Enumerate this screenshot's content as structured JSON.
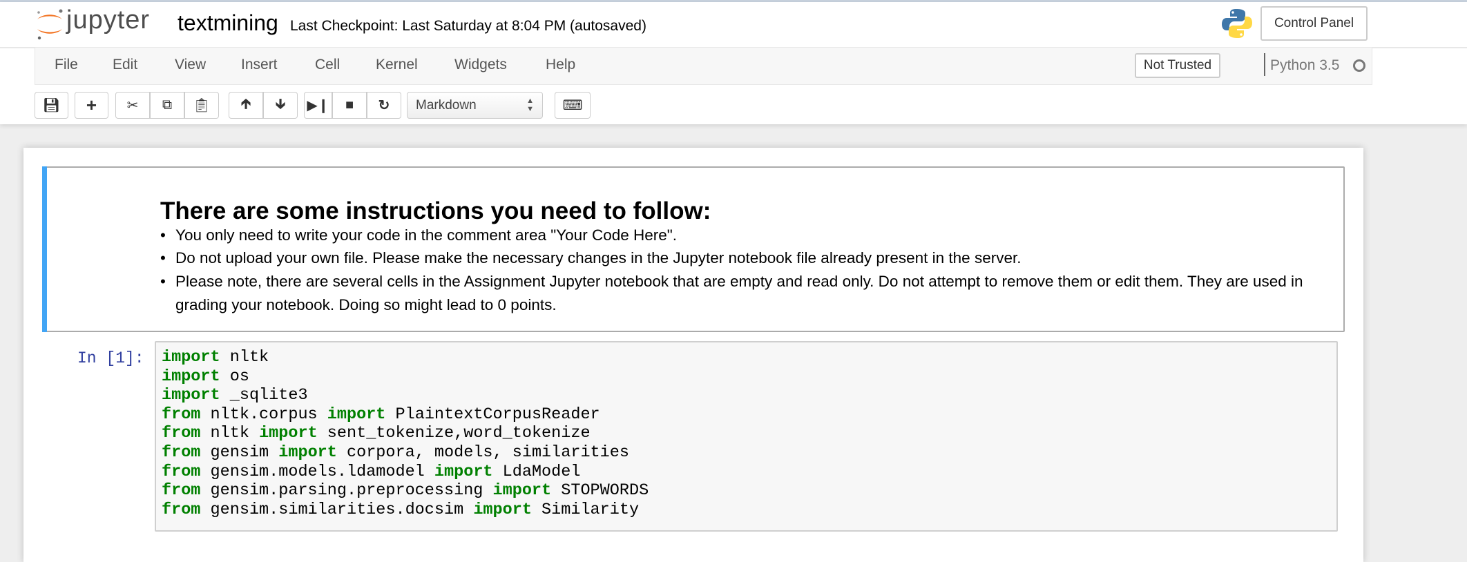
{
  "header": {
    "logo_text": "jupyter",
    "notebook_title": "textmining",
    "checkpoint": "Last Checkpoint: Last Saturday at 8:04 PM (autosaved)",
    "control_panel": "Control Panel"
  },
  "menubar": {
    "items": [
      "File",
      "Edit",
      "View",
      "Insert",
      "Cell",
      "Kernel",
      "Widgets",
      "Help"
    ],
    "trust": "Not Trusted",
    "kernel": "Python 3.5"
  },
  "toolbar": {
    "cell_type": "Markdown",
    "icons": [
      "save-icon",
      "plus-icon",
      "cut-icon",
      "copy-icon",
      "paste-icon",
      "arrow-up-icon",
      "arrow-down-icon",
      "run-icon",
      "stop-icon",
      "restart-icon",
      "keyboard-icon"
    ]
  },
  "colors": {
    "accent": "#42a5f5",
    "keyword": "#008000",
    "prompt": "#303f9f",
    "logo_orange": "#f37626"
  },
  "markdown_cell": {
    "heading": "There are some instructions you need to follow:",
    "bullets": [
      "You only need to write your code in the comment area \"Your Code Here\".",
      "Do not upload your own file. Please make the necessary changes in the Jupyter notebook file already present in the server.",
      "Please note, there are several cells in the Assignment Jupyter notebook that are empty and read only. Do not attempt to remove them or edit them. They are used in grading your notebook. Doing so might lead to 0 points."
    ]
  },
  "code_cell": {
    "prompt": "In [1]:",
    "lines": [
      [
        [
          "kw",
          "import"
        ],
        [
          "",
          "nltk"
        ]
      ],
      [
        [
          "kw",
          "import"
        ],
        [
          "",
          "os"
        ]
      ],
      [
        [
          "kw",
          "import"
        ],
        [
          "",
          "_sqlite3"
        ]
      ],
      [
        [
          "kw",
          "from"
        ],
        [
          "",
          "nltk.corpus"
        ],
        [
          "kw",
          "import"
        ],
        [
          "",
          "PlaintextCorpusReader"
        ]
      ],
      [
        [
          "kw",
          "from"
        ],
        [
          "",
          "nltk"
        ],
        [
          "kw",
          "import"
        ],
        [
          "",
          "sent_tokenize,word_tokenize"
        ]
      ],
      [
        [
          "kw",
          "from"
        ],
        [
          "",
          "gensim"
        ],
        [
          "kw",
          "import"
        ],
        [
          "",
          "corpora, models, similarities"
        ]
      ],
      [
        [
          "kw",
          "from"
        ],
        [
          "",
          "gensim.models.ldamodel"
        ],
        [
          "kw",
          "import"
        ],
        [
          "",
          "LdaModel"
        ]
      ],
      [
        [
          "kw",
          "from"
        ],
        [
          "",
          "gensim.parsing.preprocessing"
        ],
        [
          "kw",
          "import"
        ],
        [
          "",
          "STOPWORDS"
        ]
      ],
      [
        [
          "kw",
          "from"
        ],
        [
          "",
          "gensim.similarities.docsim"
        ],
        [
          "kw",
          "import"
        ],
        [
          "",
          "Similarity"
        ]
      ]
    ]
  }
}
